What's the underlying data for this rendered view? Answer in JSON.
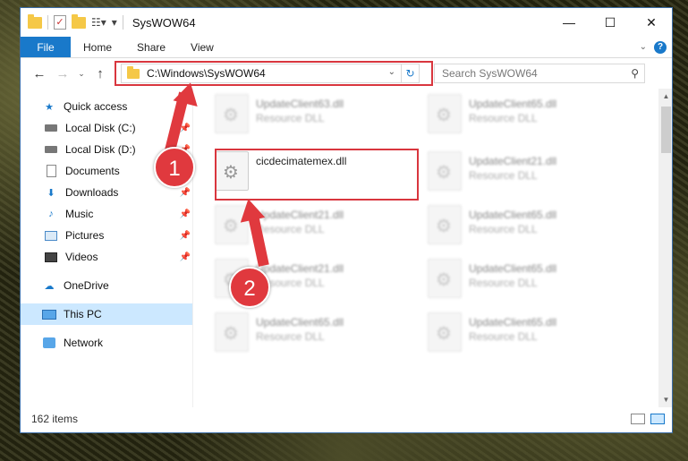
{
  "window": {
    "title": "SysWOW64",
    "controls": {
      "minimize": "—",
      "maximize": "☐",
      "close": "✕"
    }
  },
  "ribbon": {
    "file_tab": "File",
    "tabs": [
      "Home",
      "Share",
      "View"
    ],
    "expand_icon": "chevron-down-icon",
    "help_icon": "help-icon"
  },
  "nav": {
    "back": "←",
    "forward": "→",
    "recent": "⌄",
    "up": "↑"
  },
  "address": {
    "path": "C:\\Windows\\SysWOW64"
  },
  "search": {
    "placeholder": "Search SysWOW64"
  },
  "sidebar": {
    "quick_access": "Quick access",
    "items": [
      {
        "label": "Local Disk (C:)",
        "icon": "drive-icon",
        "pinned": true
      },
      {
        "label": "Local Disk (D:)",
        "icon": "drive-icon",
        "pinned": true
      },
      {
        "label": "Documents",
        "icon": "documents-icon",
        "pinned": true
      },
      {
        "label": "Downloads",
        "icon": "downloads-icon",
        "pinned": true
      },
      {
        "label": "Music",
        "icon": "music-icon",
        "pinned": true
      },
      {
        "label": "Pictures",
        "icon": "pictures-icon",
        "pinned": true
      },
      {
        "label": "Videos",
        "icon": "videos-icon",
        "pinned": true
      }
    ],
    "onedrive": "OneDrive",
    "this_pc": "This PC",
    "network": "Network"
  },
  "files": [
    {
      "name": "UpdateClient63.dll",
      "type": "Resource DLL",
      "blurred": true
    },
    {
      "name": "UpdateClient65.dll",
      "type": "Resource DLL",
      "blurred": true
    },
    {
      "name": "cicdecimatemex.dll",
      "type": "",
      "blurred": false
    },
    {
      "name": "UpdateClient21.dll",
      "type": "Resource DLL",
      "blurred": true
    },
    {
      "name": "UpdateClient21.dll",
      "type": "Resource DLL",
      "blurred": true
    },
    {
      "name": "UpdateClient65.dll",
      "type": "Resource DLL",
      "blurred": true
    },
    {
      "name": "UpdateClient21.dll",
      "type": "Resource DLL",
      "blurred": true
    },
    {
      "name": "UpdateClient65.dll",
      "type": "Resource DLL",
      "blurred": true
    },
    {
      "name": "UpdateClient65.dll",
      "type": "Resource DLL",
      "blurred": true
    },
    {
      "name": "UpdateClient65.dll",
      "type": "Resource DLL",
      "blurred": true
    }
  ],
  "status": {
    "item_count": "162 items"
  },
  "annotations": {
    "step1": "1",
    "step2": "2",
    "color": "#e0393e"
  }
}
